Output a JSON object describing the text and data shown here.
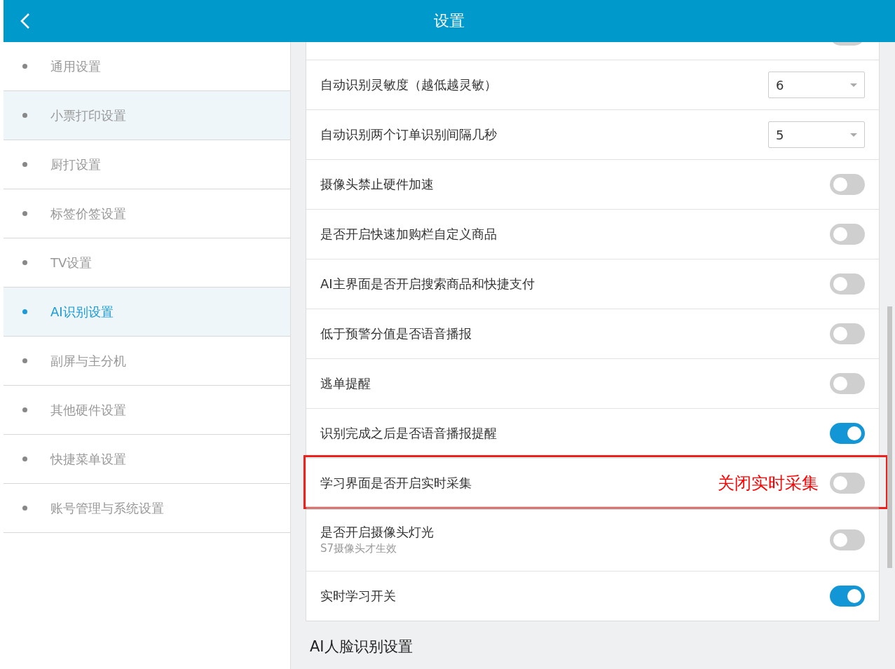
{
  "header": {
    "title": "设置"
  },
  "sidebar": {
    "items": [
      {
        "label": "通用设置",
        "selected": false,
        "highlighted": false
      },
      {
        "label": "小票打印设置",
        "selected": false,
        "highlighted": true
      },
      {
        "label": "厨打设置",
        "selected": false,
        "highlighted": false
      },
      {
        "label": "标签价签设置",
        "selected": false,
        "highlighted": false
      },
      {
        "label": "TV设置",
        "selected": false,
        "highlighted": false
      },
      {
        "label": "AI识别设置",
        "selected": true,
        "highlighted": false
      },
      {
        "label": "副屏与主分机",
        "selected": false,
        "highlighted": false
      },
      {
        "label": "其他硬件设置",
        "selected": false,
        "highlighted": false
      },
      {
        "label": "快捷菜单设置",
        "selected": false,
        "highlighted": false
      },
      {
        "label": "账号管理与系统设置",
        "selected": false,
        "highlighted": false
      }
    ]
  },
  "settings": [
    {
      "kind": "toggle",
      "on": false
    },
    {
      "kind": "select",
      "label": "自动识别灵敏度（越低越灵敏）",
      "value": "6"
    },
    {
      "kind": "select",
      "label": "自动识别两个订单识别间隔几秒",
      "value": "5"
    },
    {
      "kind": "toggle",
      "label": "摄像头禁止硬件加速",
      "on": false
    },
    {
      "kind": "toggle",
      "label": "是否开启快速加购栏自定义商品",
      "on": false
    },
    {
      "kind": "toggle",
      "label": "AI主界面是否开启搜索商品和快捷支付",
      "on": false
    },
    {
      "kind": "toggle",
      "label": "低于预警分值是否语音播报",
      "on": false
    },
    {
      "kind": "toggle",
      "label": "逃单提醒",
      "on": false
    },
    {
      "kind": "toggle",
      "label": "识别完成之后是否语音播报提醒",
      "on": true
    },
    {
      "kind": "toggle",
      "label": "学习界面是否开启实时采集",
      "on": false,
      "annotation": "关闭实时采集"
    },
    {
      "kind": "toggle",
      "label": "是否开启摄像头灯光",
      "sublabel": "S7摄像头才生效",
      "on": false
    },
    {
      "kind": "toggle",
      "label": "实时学习开关",
      "on": true
    }
  ],
  "next_section": {
    "title": "AI人脸识别设置"
  }
}
